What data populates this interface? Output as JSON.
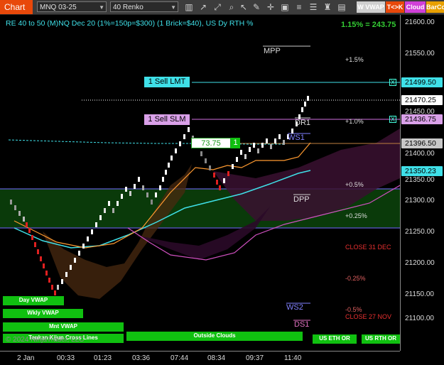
{
  "toolbar": {
    "chart_label": "Chart",
    "instrument": "MNQ 03-25",
    "bar_type": "40 Renko",
    "vwap_button": "W VWAP",
    "tk_button": "T<>K",
    "cloud_button": "Cloud",
    "barco_button": "BarCo"
  },
  "chart": {
    "title": "RE 40 to 50 (M)NQ Dec 20 (1%=150p=$300) (1 Brick=$40), US Dy RTH %",
    "pct_readout": "1.15% = 243.75",
    "watermark": "© 2024 NinjaTrader, LLC"
  },
  "yaxis": {
    "labels": [
      "21600.00",
      "21550.00",
      "21500.00",
      "21450.00",
      "21400.00",
      "21350.00",
      "21300.00",
      "21250.00",
      "21200.00",
      "21150.00",
      "21100.00"
    ]
  },
  "xaxis": {
    "labels": [
      "2 Jan",
      "00:33",
      "01:23",
      "03:36",
      "07:44",
      "08:34",
      "09:37",
      "11:40"
    ]
  },
  "price_tags": {
    "sell_lmt_price": "21499.50",
    "last_price": "21470.25",
    "sell_slm_price": "21436.75",
    "level_price": "21396.50",
    "cloud_price": "21350.23"
  },
  "orders": {
    "sell_lmt": "1 Sell LMT",
    "sell_slm": "1 Sell SLM",
    "position_pnl": "73.75",
    "position_qty": "1",
    "close_icon": "X"
  },
  "levels": {
    "mpp": "MPP",
    "dr1": "DR1",
    "ws1": "WS1",
    "dpp": "DPP",
    "ws2": "WS2",
    "ds1": "DS1"
  },
  "percent_lines": {
    "p15": "+1.5%",
    "p10": "+1.0%",
    "p05": "+0.5%",
    "p025": "+0.25%",
    "m025": "-0.25%",
    "m05": "-0.5%",
    "close31": "CLOSE 31 DEC",
    "close27": "CLOSE 27 NOV"
  },
  "buttons": {
    "day_vwap": "Day VWAP",
    "wkly_vwap": "Wkly VWAP",
    "mnt_vwap": "Mnt VWAP",
    "tenkan": "Tenkan Kijun Cross Lines",
    "outside": "Outside Clouds",
    "us_eth": "US ETH OR",
    "us_rth": "US RTH OR"
  },
  "colors": {
    "accent": "#e8480a",
    "cyan": "#3fe0e8",
    "magenta": "#d070e0",
    "green_button": "#10c010",
    "pct_readout": "#33cc33"
  }
}
